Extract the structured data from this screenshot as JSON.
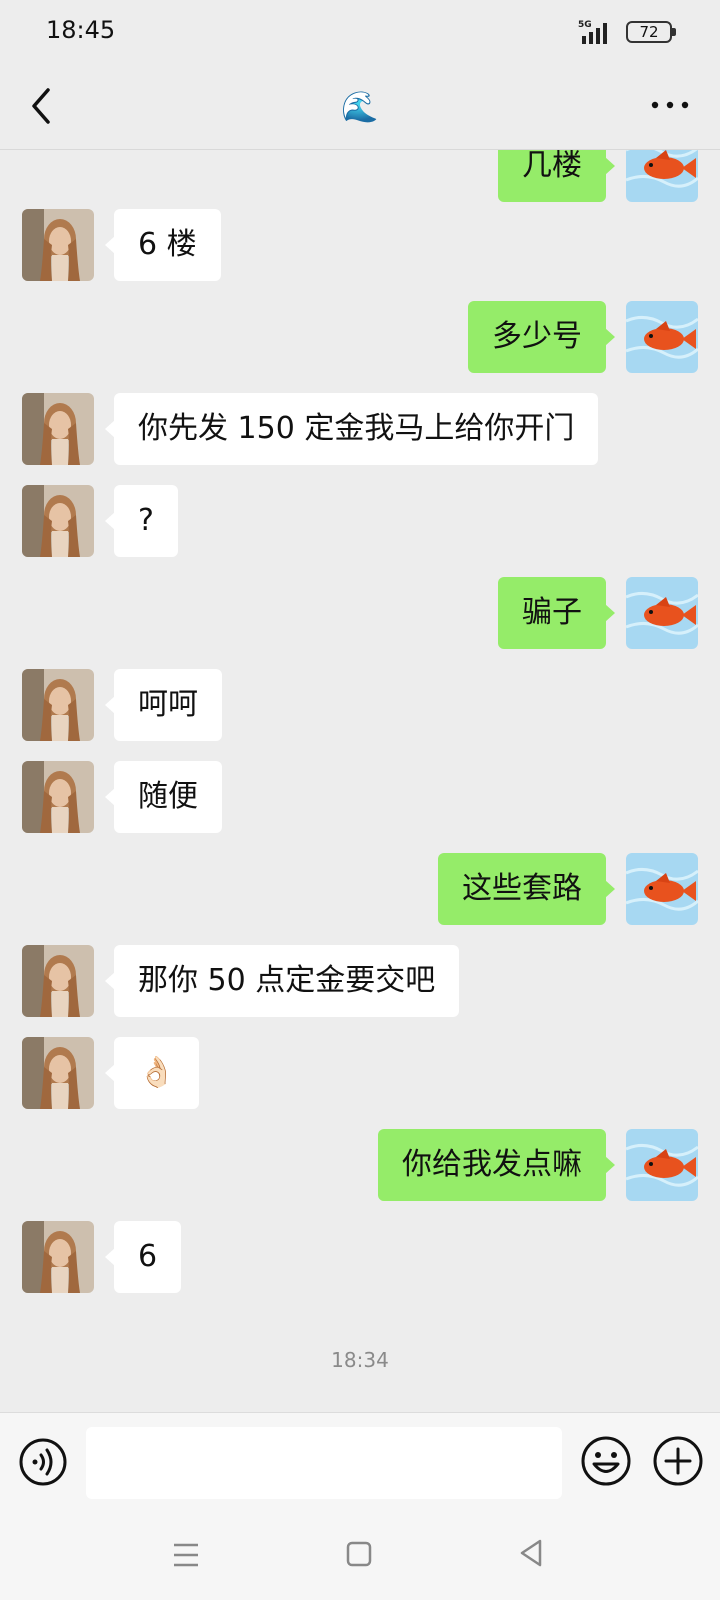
{
  "status_bar": {
    "time": "18:45",
    "network": "5G",
    "battery": "72"
  },
  "header": {
    "title_emoji": "🌊",
    "back_icon": "chevron-left-icon",
    "more_icon": "ellipsis-icon"
  },
  "messages": [
    {
      "side": "out",
      "text": "几楼"
    },
    {
      "side": "in",
      "text": "6 楼"
    },
    {
      "side": "out",
      "text": "多少号"
    },
    {
      "side": "in",
      "text": "你先发 150 定金我马上给你开门"
    },
    {
      "side": "in",
      "text": "?"
    },
    {
      "side": "out",
      "text": "骗子"
    },
    {
      "side": "in",
      "text": "呵呵"
    },
    {
      "side": "in",
      "text": "随便"
    },
    {
      "side": "out",
      "text": "这些套路"
    },
    {
      "side": "in",
      "text": "那你 50 点定金要交吧"
    },
    {
      "side": "in",
      "text": "👌🏻"
    },
    {
      "side": "out",
      "text": "你给我发点嘛"
    },
    {
      "side": "in",
      "text": "6"
    }
  ],
  "timestamp": "18:34",
  "input_bar": {
    "placeholder": "",
    "voice_icon": "voice-icon",
    "emoji_icon": "emoji-icon",
    "plus_icon": "plus-icon"
  },
  "colors": {
    "background": "#ededed",
    "outgoing_bubble": "#95ec69",
    "incoming_bubble": "#ffffff"
  }
}
